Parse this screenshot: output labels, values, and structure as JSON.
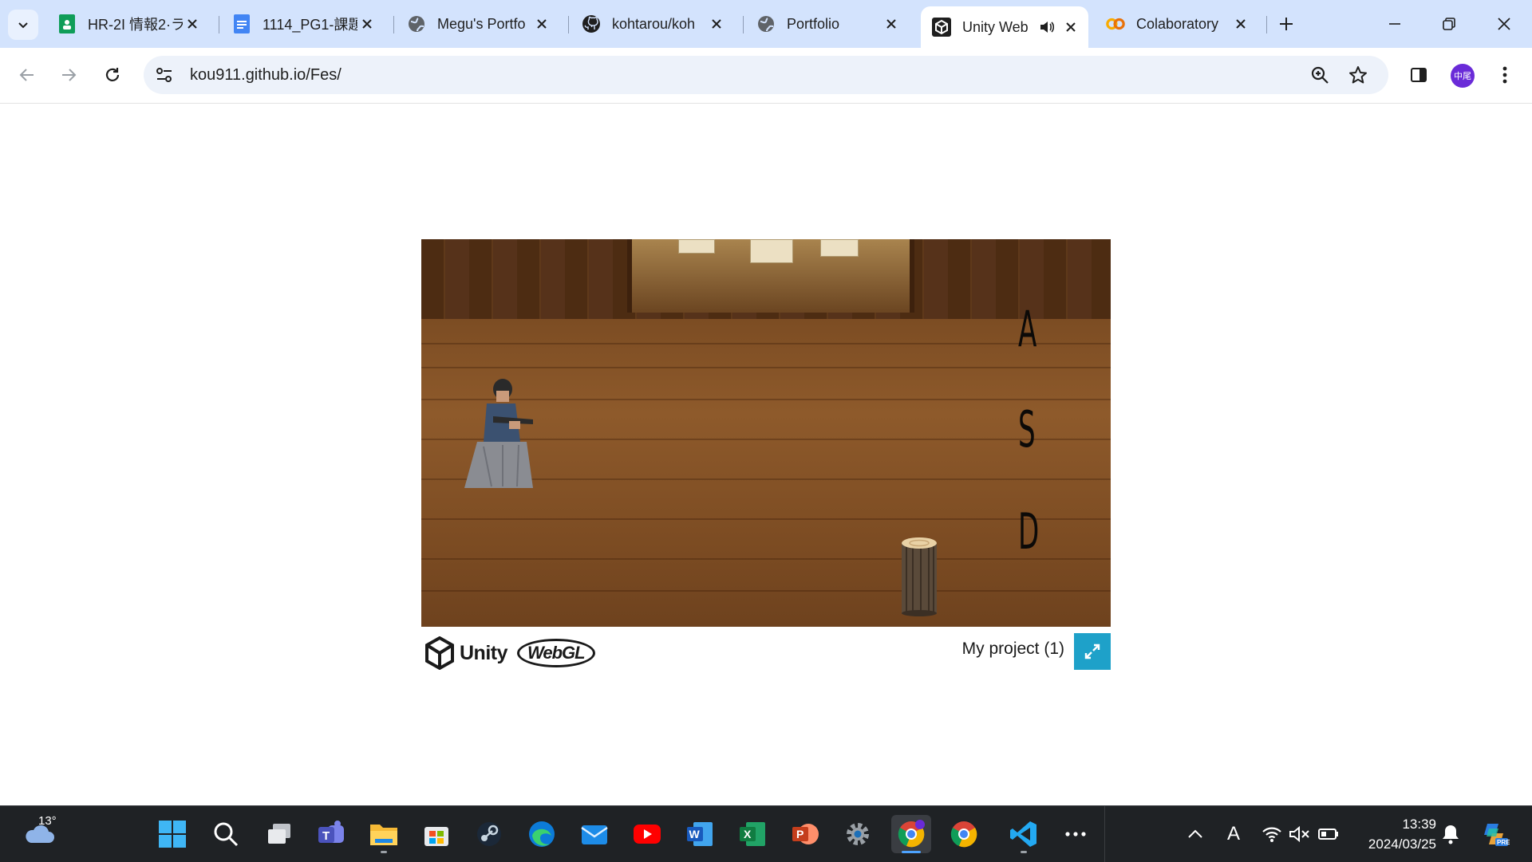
{
  "browser": {
    "tabs": [
      {
        "title": "HR-2I 情報2·ラ",
        "icon": "sheets-icon"
      },
      {
        "title": "1114_PG1-課題",
        "icon": "docs-icon"
      },
      {
        "title": "Megu's Portfo",
        "icon": "globe-icon"
      },
      {
        "title": "kohtarou/koh",
        "icon": "github-icon"
      },
      {
        "title": "Portfolio",
        "icon": "globe-icon"
      },
      {
        "title": "Unity Web",
        "icon": "unity-icon",
        "active": true
      },
      {
        "title": "Colaboratory",
        "icon": "colab-icon"
      }
    ],
    "url": "kou911.github.io/Fes/",
    "profile_initials": "中尾"
  },
  "game": {
    "keys": [
      "A",
      "S",
      "D"
    ],
    "engine_label": "Unity",
    "webgl_label": "WebGL",
    "project_title": "My project (1)"
  },
  "taskbar": {
    "weather_temp": "13°",
    "time": "13:39",
    "date": "2024/03/25",
    "ime_label": "A",
    "apps": [
      "start",
      "search",
      "task-view",
      "teams",
      "file-explorer",
      "store",
      "steam",
      "edge",
      "mail",
      "youtube",
      "word",
      "excel",
      "powerpoint",
      "settings",
      "chrome-profile",
      "chrome",
      "vscode",
      "more"
    ]
  },
  "colors": {
    "tab_strip_bg": "#d3e3fd",
    "fullscreen_accent": "#1ea1c9",
    "taskbar_bg": "#1f2225"
  }
}
